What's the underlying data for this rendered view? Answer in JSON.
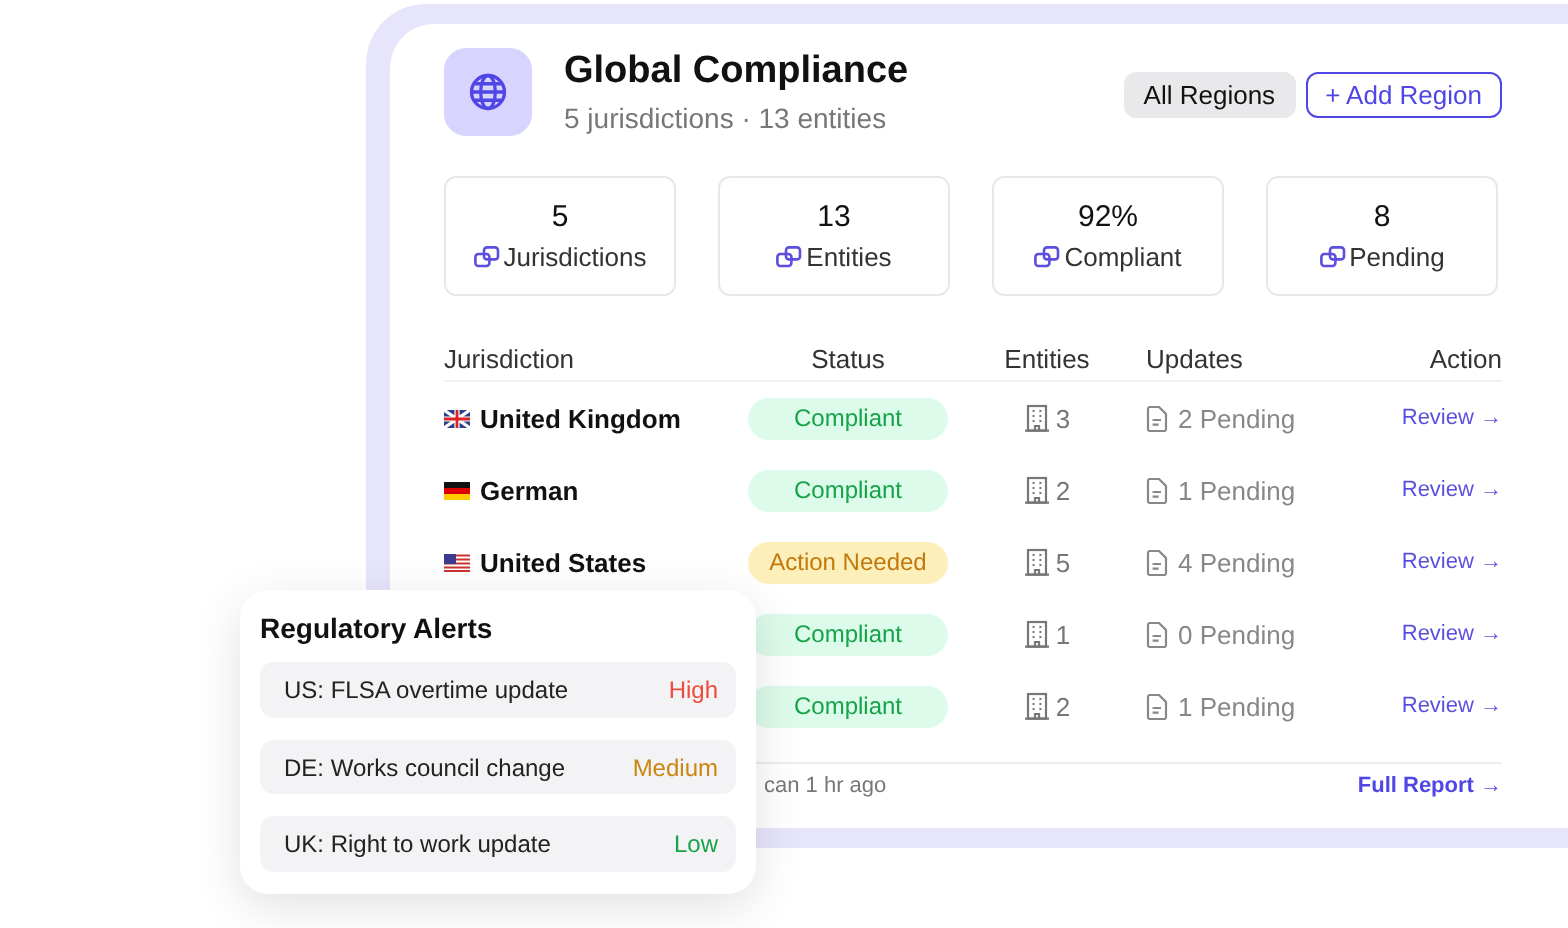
{
  "header": {
    "title": "Global Compliance",
    "subtitle": "5 jurisdictions · 13 entities",
    "buttons": [
      {
        "label": "All Regions",
        "kind": "filter"
      },
      {
        "label": "+ Add Region",
        "kind": "outline"
      }
    ]
  },
  "stats": [
    {
      "value": "5",
      "label": "Jurisdictions"
    },
    {
      "value": "13",
      "label": "Entities"
    },
    {
      "value": "92%",
      "label": "Compliant"
    },
    {
      "value": "8",
      "label": "Pending"
    }
  ],
  "table": {
    "columns": [
      "Jurisdiction",
      "Status",
      "Entities",
      "Updates",
      "Action"
    ],
    "rows": [
      {
        "jurisdiction": "United Kingdom",
        "status": {
          "label": "Compliant",
          "kind": "ok"
        },
        "entities": "3",
        "updates": "2 Pending",
        "action": "Review →"
      },
      {
        "jurisdiction": "German",
        "status": {
          "label": "Compliant",
          "kind": "ok"
        },
        "entities": "2",
        "updates": "1 Pending",
        "action": "Review →"
      },
      {
        "jurisdiction": "United States",
        "status": {
          "label": "Action Needed",
          "kind": "warn"
        },
        "entities": "5",
        "updates": "4 Pending",
        "action": "Review →"
      },
      {
        "status": {
          "label": "Compliant",
          "kind": "ok"
        },
        "entities": "1",
        "updates": "0 Pending",
        "action": "Review →"
      },
      {
        "status": {
          "label": "Compliant",
          "kind": "ok"
        },
        "entities": "2",
        "updates": "1 Pending",
        "action": "Review →"
      }
    ]
  },
  "footer": {
    "note": "can 1 hr ago",
    "link": "Full Report →"
  },
  "alerts": {
    "title": "Regulatory Alerts",
    "items": [
      {
        "text": "US: FLSA overtime update",
        "severity": "High",
        "kind": "high"
      },
      {
        "text": "DE: Works council change",
        "severity": "Medium",
        "kind": "medium"
      },
      {
        "text": "UK: Right to work update",
        "severity": "Low",
        "kind": "low"
      }
    ]
  }
}
